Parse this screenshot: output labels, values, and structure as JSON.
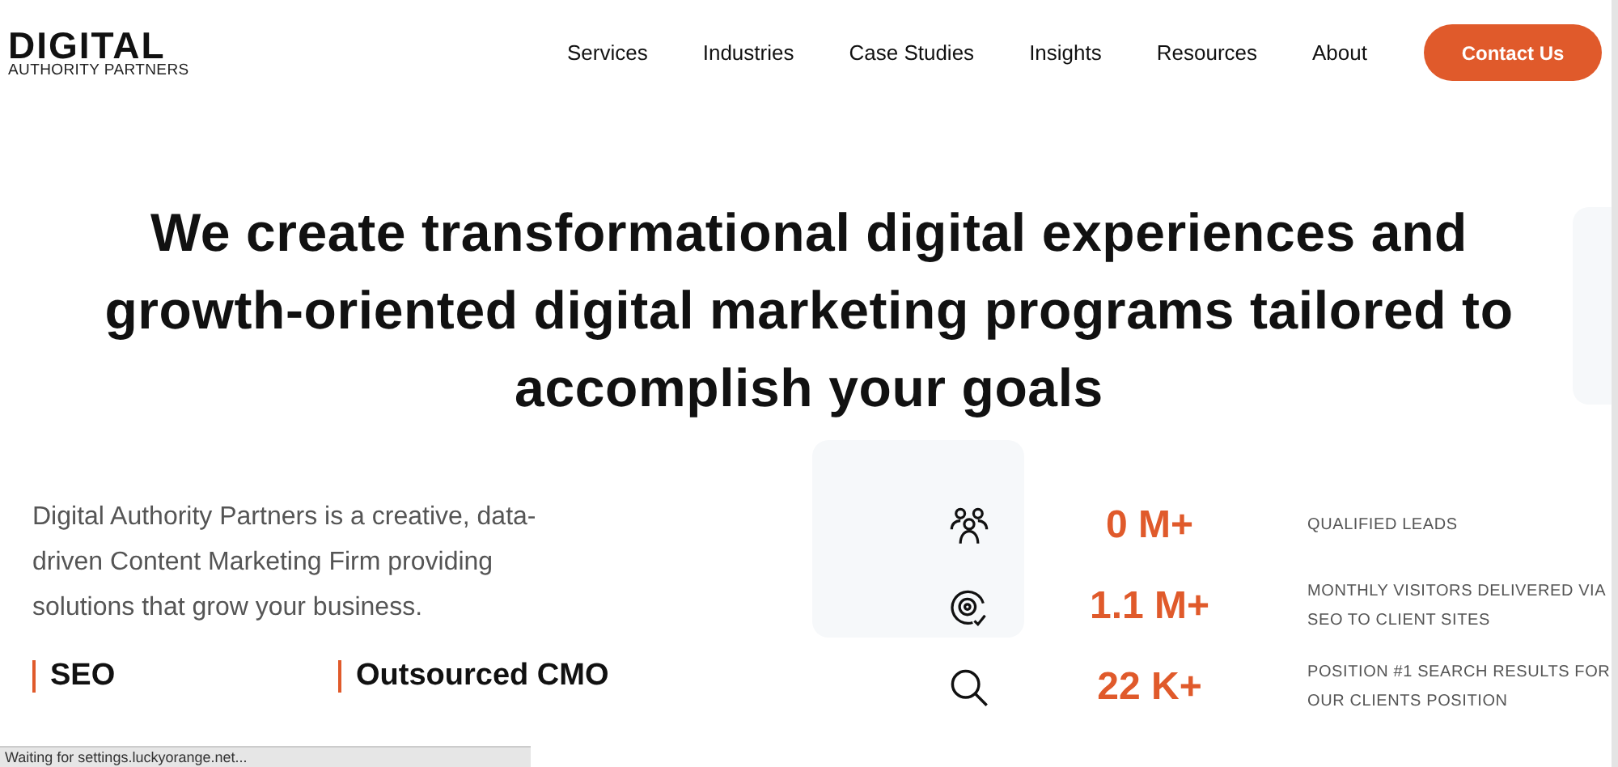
{
  "logo": {
    "wordmark": "DIGITAL",
    "tagline": "AUTHORITY PARTNERS"
  },
  "nav": {
    "items": [
      "Services",
      "Industries",
      "Case Studies",
      "Insights",
      "Resources",
      "About"
    ],
    "cta": "Contact Us"
  },
  "hero": {
    "heading": "We create transformational digital experiences and growth-oriented digital marketing programs tailored to accomplish your goals"
  },
  "intro": "Digital Authority Partners is a creative, data-driven Content Marketing Firm providing solutions that grow your business.",
  "services": [
    "SEO",
    "Outsourced CMO"
  ],
  "stats": [
    {
      "kind": "people",
      "value": "0 M+",
      "label": "QUALIFIED LEADS"
    },
    {
      "kind": "target",
      "value": "1.1 M+",
      "label": "MONTHLY VISITORS DELIVERED VIA SEO TO CLIENT SITES"
    },
    {
      "kind": "search",
      "value": "22 K+",
      "label": "POSITION #1 SEARCH RESULTS FOR OUR CLIENTS POSITION"
    }
  ],
  "status_bar": "Waiting for settings.luckyorange.net..."
}
